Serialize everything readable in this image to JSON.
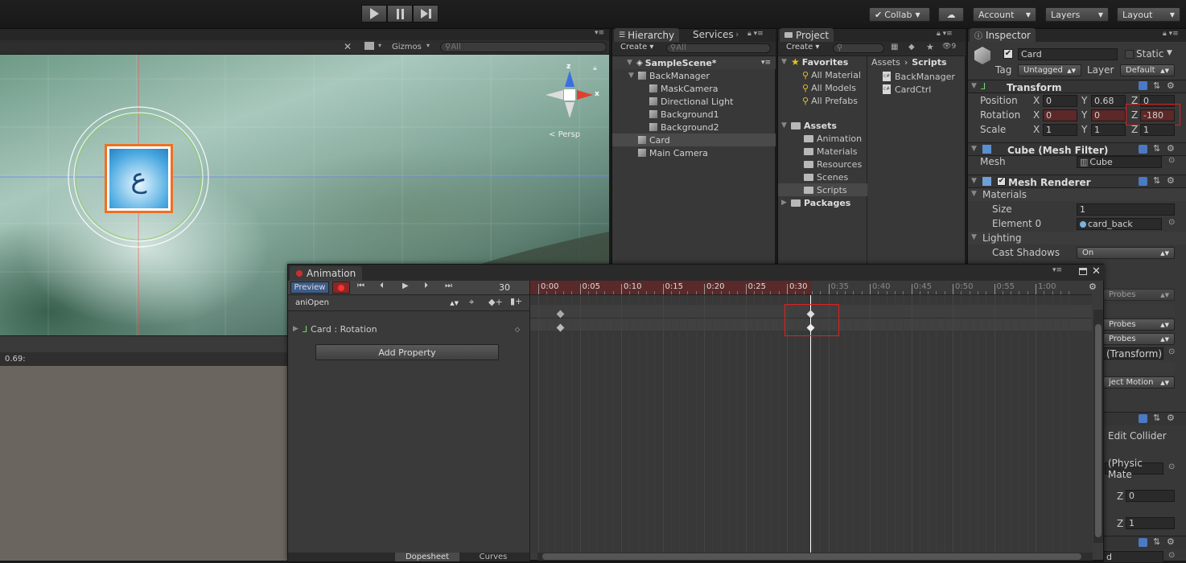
{
  "toolbar": {
    "collab": "Collab",
    "account": "Account",
    "layers": "Layers",
    "layout": "Layout"
  },
  "scene": {
    "gizmos": "Gizmos",
    "search_placeholder": "All",
    "persp": "Persp",
    "gizmo_y": "z",
    "gizmo_x": "x",
    "status_value": "0.69:"
  },
  "hierarchy": {
    "tab": "Hierarchy",
    "services_tab": "Services",
    "create": "Create",
    "search_placeholder": "All",
    "scene_name": "SampleScene*",
    "items": [
      {
        "label": "BackManager",
        "level": 1,
        "expanded": true
      },
      {
        "label": "MaskCamera",
        "level": 2
      },
      {
        "label": "Directional Light",
        "level": 2
      },
      {
        "label": "Background1",
        "level": 2
      },
      {
        "label": "Background2",
        "level": 2
      },
      {
        "label": "Card",
        "level": 1,
        "selected": true
      },
      {
        "label": "Main Camera",
        "level": 1
      }
    ]
  },
  "project": {
    "tab": "Project",
    "create": "Create",
    "favorites": "Favorites",
    "favorites_items": [
      "All Material",
      "All Models",
      "All Prefabs"
    ],
    "assets": "Assets",
    "assets_items": [
      "Animation",
      "Materials",
      "Resources",
      "Scenes",
      "Scripts"
    ],
    "packages": "Packages",
    "breadcrumb_root": "Assets",
    "breadcrumb_current": "Scripts",
    "scripts": [
      "BackManager",
      "CardCtrl"
    ],
    "visible_count": "9"
  },
  "inspector": {
    "tab": "Inspector",
    "object_name": "Card",
    "static": "Static",
    "tag_label": "Tag",
    "tag_value": "Untagged",
    "layer_label": "Layer",
    "layer_value": "Default",
    "transform": {
      "title": "Transform",
      "position_label": "Position",
      "rotation_label": "Rotation",
      "scale_label": "Scale",
      "position": {
        "x": "0",
        "y": "0.68",
        "z": "0"
      },
      "rotation": {
        "x": "0",
        "y": "0",
        "z": "-180"
      },
      "scale": {
        "x": "1",
        "y": "1",
        "z": "1"
      }
    },
    "mesh_filter": {
      "title": "Cube (Mesh Filter)",
      "mesh_label": "Mesh",
      "mesh_value": "Cube"
    },
    "mesh_renderer": {
      "title": "Mesh Renderer",
      "materials": "Materials",
      "size_label": "Size",
      "size_value": "1",
      "element_label": "Element 0",
      "element_value": "card_back",
      "lighting": "Lighting",
      "cast_shadows_label": "Cast Shadows",
      "cast_shadows_value": "On"
    },
    "partial": {
      "probes1": "Probes",
      "probes2": "Probes",
      "probes3": "Probes",
      "transform_ref": "(Transform)",
      "object_motion": "ject Motion",
      "edit_collider": "Edit Collider",
      "physic_mat": "(Physic Mate",
      "z_label": "Z",
      "z1": "0",
      "z2": "1",
      "bottom": "d"
    }
  },
  "animation": {
    "tab": "Animation",
    "preview": "Preview",
    "samples": "30",
    "clip": "aniOpen",
    "property": "Card : Rotation",
    "add_property": "Add Property",
    "timeline_labels": [
      "0:00",
      "0:05",
      "0:10",
      "0:15",
      "0:20",
      "0:25",
      "0:30",
      "0:35",
      "0:40",
      "0:45",
      "0:50",
      "0:55",
      "1:00"
    ],
    "dopesheet": "Dopesheet",
    "curves": "Curves"
  },
  "colors": {
    "accent_red": "#c83030",
    "highlight_box": "#e02020",
    "selection": "#3e5f96"
  }
}
